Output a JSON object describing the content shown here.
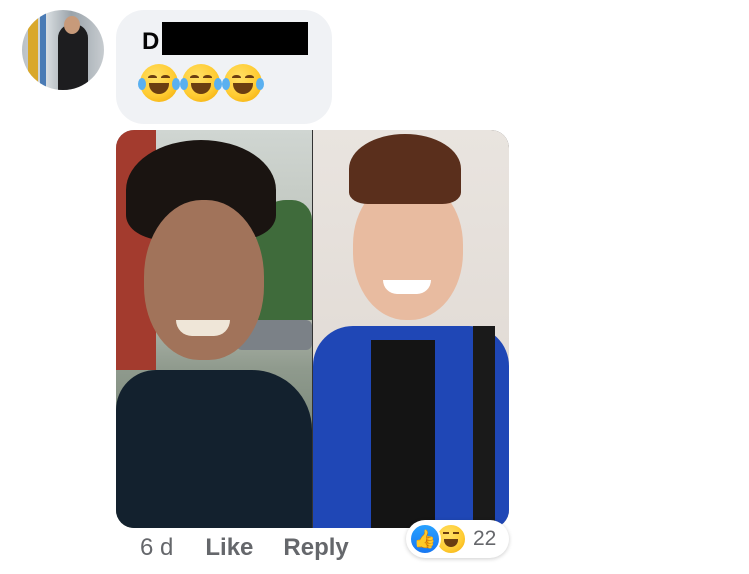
{
  "comment": {
    "author_visible": "D",
    "emoji_text": "😂😂😂",
    "emoji_icon": "face-with-tears-of-joy",
    "emoji_count": 3
  },
  "photo": {
    "description_icon": "before-after-photo"
  },
  "footer": {
    "time": "6 d",
    "like_label": "Like",
    "reply_label": "Reply"
  },
  "reactions": {
    "types": [
      "like",
      "haha"
    ],
    "count": "22"
  },
  "colors": {
    "bubble": "#f0f2f5",
    "meta_text": "#65676b",
    "like_blue": "#1877f2",
    "redaction": "#000000"
  }
}
